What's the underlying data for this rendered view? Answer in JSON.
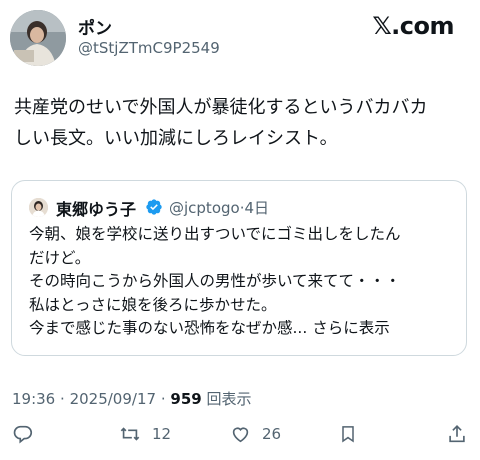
{
  "author": {
    "name": "ポン",
    "handle": "@tStjZTmC9P2549",
    "avatar_icon": "user-avatar"
  },
  "brand": "𝕏.com",
  "post": {
    "lines": [
      "共産党のせいで外国人が暴徒化するというバカバカ",
      "しい長文。いい加減にしろレイシスト。"
    ]
  },
  "quoted_post": {
    "name": "東郷ゆう子",
    "verified_icon": "verified-badge-icon",
    "handle": "@jcptogo",
    "separator": "·",
    "age": "4日",
    "lines": [
      "今朝、娘を学校に送り出すついでにゴミ出しをしたん",
      "だけど。",
      "その時向こうから外国人の男性が歩いて来てて・・・",
      "私はとっさに娘を後ろに歩かせた。",
      "今まで感じた事のない恐怖をなぜか感... さらに表示"
    ]
  },
  "meta": {
    "time": "19:36",
    "sep": "·",
    "date": "2025/09/17",
    "views": "959",
    "views_label": "回表示"
  },
  "actions": {
    "reply_icon": "reply-icon",
    "repost_icon": "repost-icon",
    "repost_count": "12",
    "like_icon": "heart-icon",
    "like_count": "26",
    "bookmark_icon": "bookmark-icon",
    "share_icon": "share-icon"
  },
  "colors": {
    "text": "#0f1419",
    "secondary": "#536471",
    "border": "#cfd9de",
    "verified": "#1d9bf0"
  }
}
